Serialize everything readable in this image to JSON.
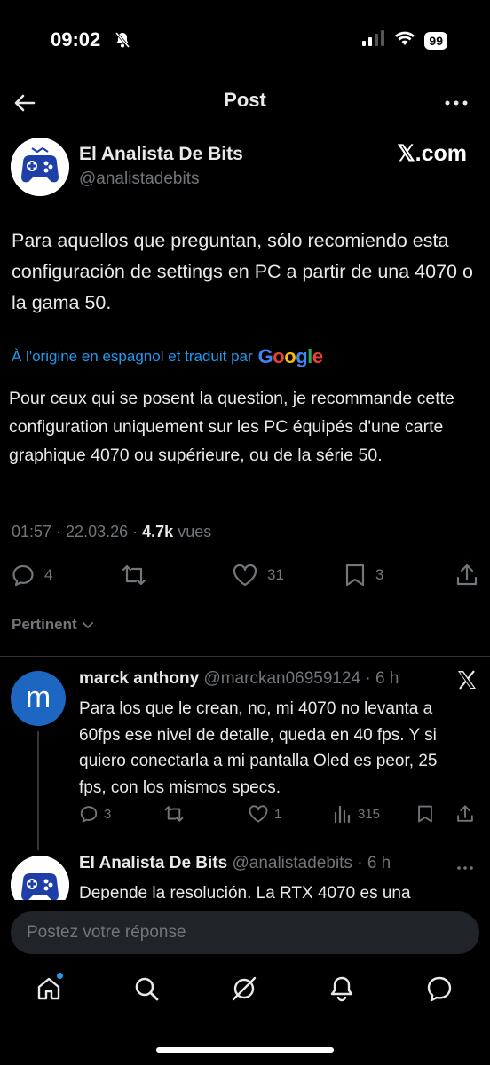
{
  "status_bar": {
    "time": "09:02",
    "battery": "99"
  },
  "header": {
    "title": "Post"
  },
  "post": {
    "author_name": "El Analista De Bits",
    "author_handle": "@analistadebits",
    "source_badge": "𝕏.com",
    "text": "Para aquellos que preguntan, sólo recomiendo esta configuración de settings en PC a partir de una 4070 o la gama 50.",
    "translation_label": "À l'origine en espagnol et traduit par",
    "translation_provider": "Google",
    "translated_text": "Pour ceux qui se posent la question, je recommande cette configuration uniquement sur les PC équipés d'une carte graphique 4070 ou supérieure, ou de la série 50.",
    "timestamp": "01:57 · 22.03.26 ·",
    "views_count": "4.7k",
    "views_label": "vues",
    "replies": "4",
    "likes": "31",
    "bookmarks": "3"
  },
  "sort": {
    "label": "Pertinent"
  },
  "replies": [
    {
      "avatar_letter": "m",
      "name": "marck anthony",
      "handle": "@marckan06959124",
      "time": "· 6 h",
      "text": "Para los que le crean, no, mi 4070 no levanta a 60fps ese nivel de detalle, queda en 40 fps. Y si quiero conectarla a mi pantalla Oled es peor, 25 fps, con los mismos specs.",
      "replies": "3",
      "likes": "1",
      "views": "315"
    },
    {
      "name": "El Analista De Bits",
      "handle": "@analistadebits",
      "time": "· 6 h",
      "text": "Depende la resolución. La RTX 4070 es una"
    }
  ],
  "composer": {
    "placeholder": "Postez votre réponse"
  },
  "colors": {
    "accent": "#1d9bf0",
    "muted": "#71767b",
    "background": "#000000"
  }
}
